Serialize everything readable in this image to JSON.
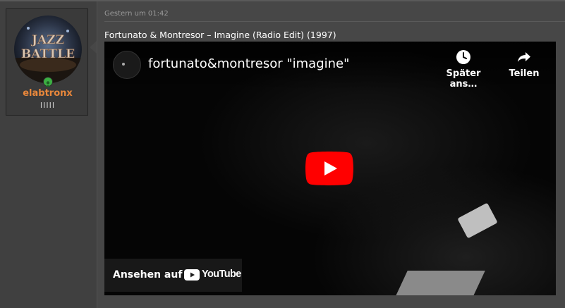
{
  "user": {
    "name": "elabtronx",
    "rank": "IIIII",
    "status": "online",
    "avatar_text": "JAZZ BATTLE"
  },
  "post": {
    "timestamp": "Gestern um 01:42",
    "title": "Fortunato & Montresor – Imagine (Radio Edit) (1997)"
  },
  "video": {
    "title": "fortunato&montresor \"imagine\"",
    "watch_later_label": "Später ans…",
    "share_label": "Teilen",
    "watch_on_label": "Ansehen auf",
    "platform_name": "YouTube"
  },
  "colors": {
    "username": "#e8873b",
    "status_online": "#3cb043",
    "play_button": "#ff0000"
  }
}
